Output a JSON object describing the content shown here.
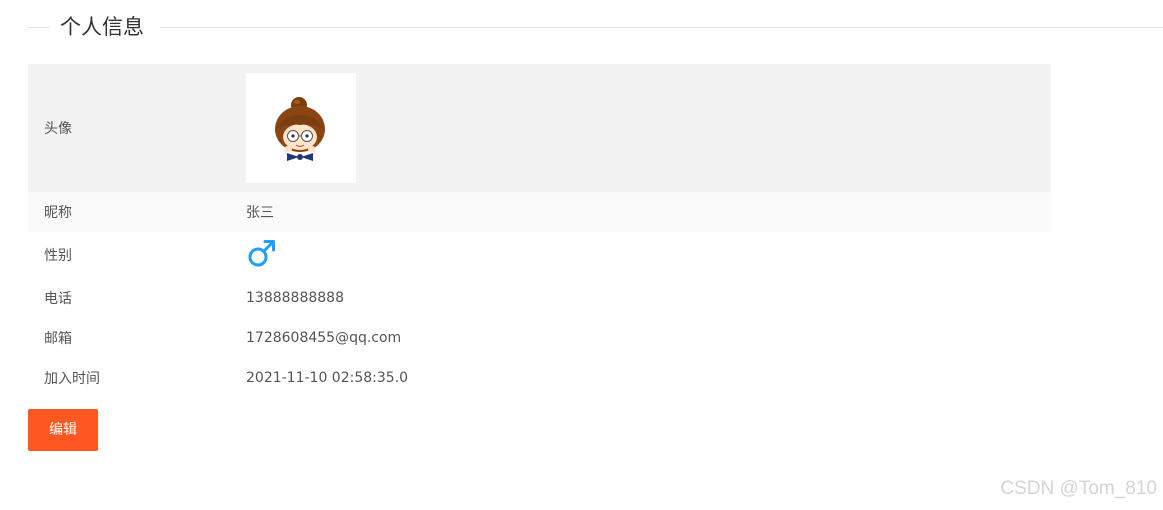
{
  "section": {
    "title": "个人信息"
  },
  "profile": {
    "avatar_label": "头像",
    "nickname_label": "昵称",
    "nickname": "张三",
    "gender_label": "性别",
    "gender_icon": "male-symbol-icon",
    "gender_color": "#1e9fff",
    "phone_label": "电话",
    "phone": "13888888888",
    "email_label": "邮箱",
    "email": "1728608455@qq.com",
    "joined_label": "加入时间",
    "joined": "2021-11-10 02:58:35.0"
  },
  "actions": {
    "edit_label": "编辑",
    "edit_color": "#ff5722"
  },
  "watermark": "CSDN @Tom_810"
}
